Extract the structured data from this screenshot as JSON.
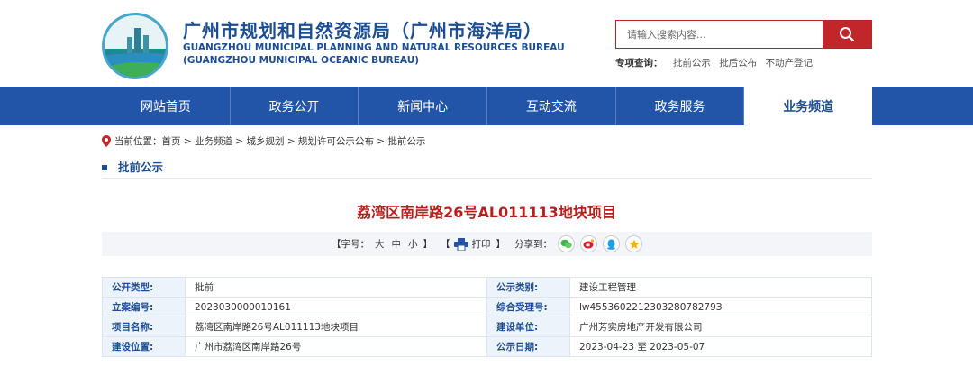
{
  "header": {
    "title_cn": "广州市规划和自然资源局（广州市海洋局）",
    "title_en_1": "GUANGZHOU MUNICIPAL PLANNING AND NATURAL RESOURCES BUREAU",
    "title_en_2": "(GUANGZHOU MUNICIPAL OCEANIC BUREAU)",
    "search_placeholder": "请输入搜索内容...",
    "special_label": "专项查询：",
    "special_links": [
      "批前公示",
      "批后公布",
      "不动产登记"
    ]
  },
  "nav": {
    "items": [
      "网站首页",
      "政务公开",
      "新闻中心",
      "互动交流",
      "政务服务",
      "业务频道"
    ],
    "active_index": 5
  },
  "breadcrumb": {
    "label": "当前位置：",
    "path": "首页 > 业务频道 > 城乡规划 > 规划许可公示公布 > 批前公示"
  },
  "section_title": "批前公示",
  "article": {
    "title": "荔湾区南岸路26号AL011113地块项目"
  },
  "tools": {
    "font_size_label": "【字号：",
    "font_large": "大",
    "font_medium": "中",
    "font_small": "小",
    "font_close": "】",
    "print_open": "【",
    "print_label": "打印",
    "print_close": "】",
    "share_label": "分享到："
  },
  "table": {
    "rows": [
      {
        "k1": "公开类型:",
        "v1": "批前",
        "k2": "公示类别:",
        "v2": "建设工程管理"
      },
      {
        "k1": "立案编号:",
        "v1": "2023030000010161",
        "k2": "综合受理号:",
        "v2": "lw455360221230328078279З"
      },
      {
        "k1": "项目名称:",
        "v1": "荔湾区南岸路26号AL011113地块项目",
        "k2": "建设单位:",
        "v2": "广州芳实房地产开发有限公司"
      },
      {
        "k1": "建设位置:",
        "v1": "广州市荔湾区南岸路26号",
        "k2": "公示日期:",
        "v2": "2023-04-23 至 2023-05-07"
      }
    ]
  },
  "colors": {
    "brand_blue": "#2254a8",
    "title_blue": "#1c4d92",
    "accent_red": "#c0262a",
    "article_red": "#b5201d"
  }
}
